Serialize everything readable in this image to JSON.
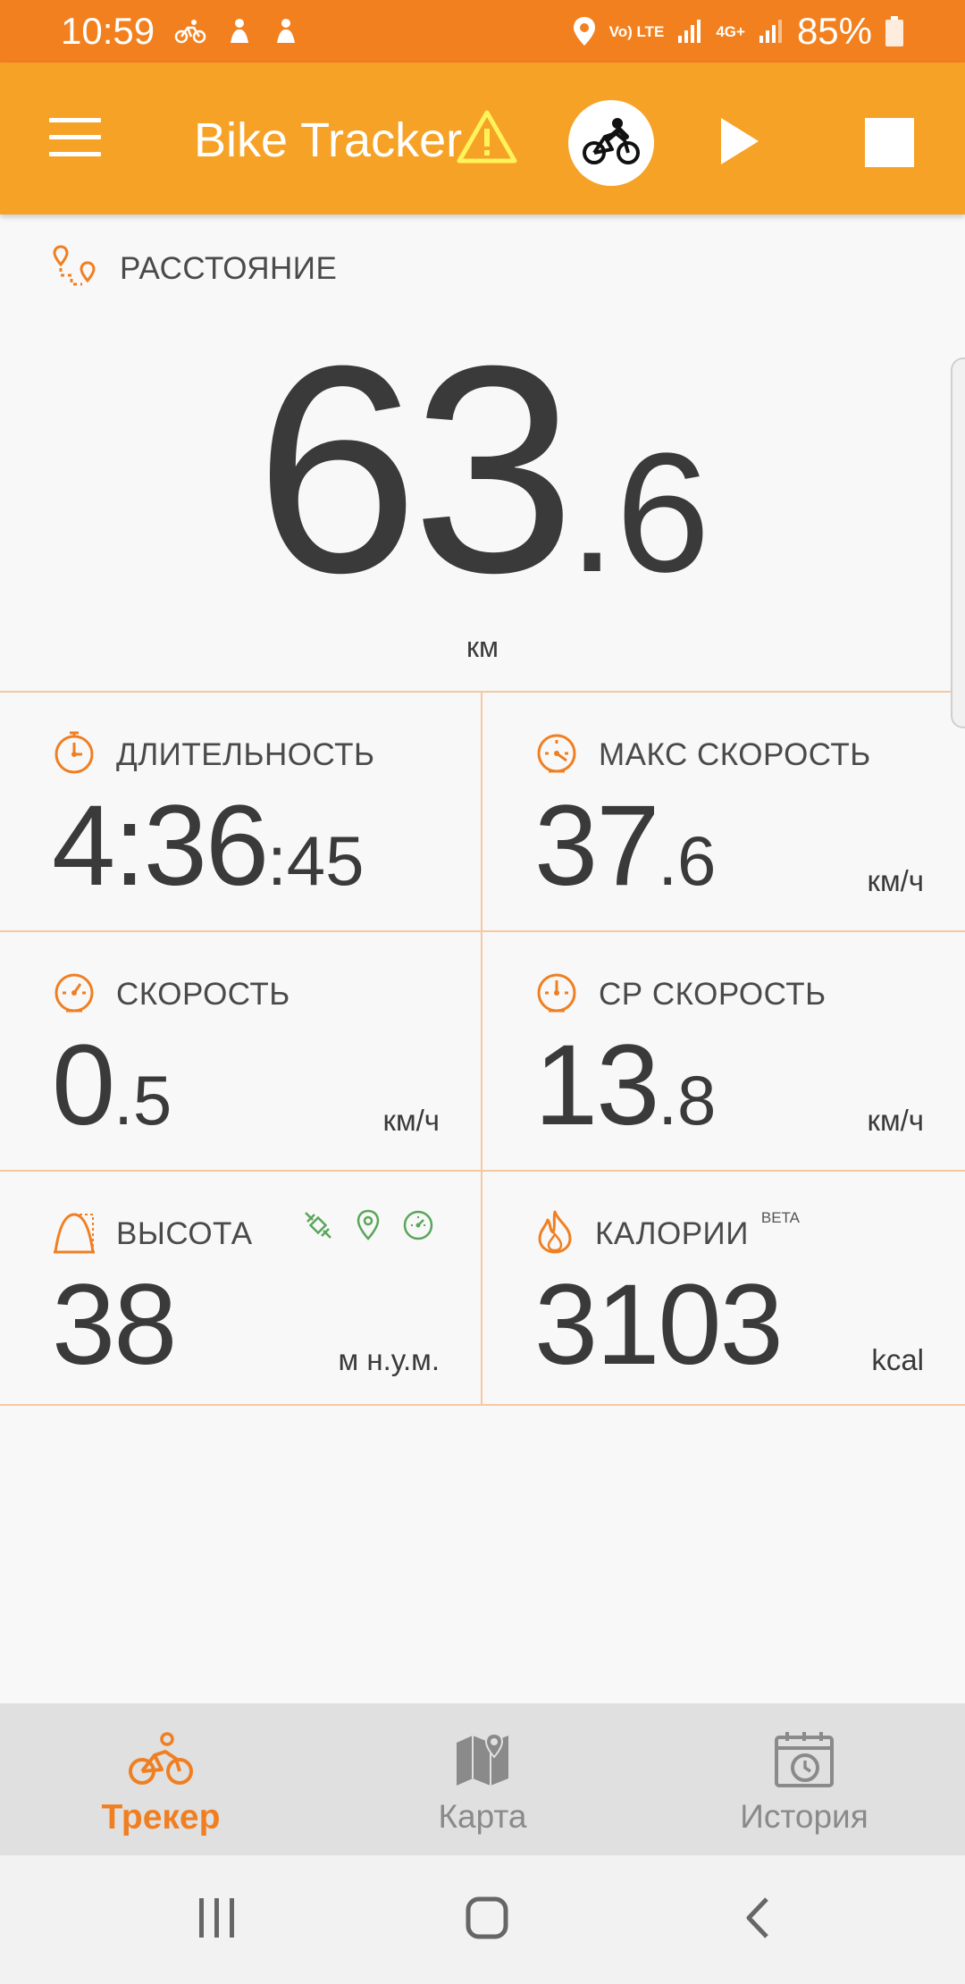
{
  "status_bar": {
    "time": "10:59",
    "battery": "85%",
    "network_lte": "Vo) LTE",
    "network_4g": "4G+"
  },
  "app_bar": {
    "title": "Bike Tracker",
    "menu_icon": "hamburger-menu-icon",
    "warning_icon": "warning-icon",
    "activity_icon": "cyclist-icon",
    "play_icon": "play-icon",
    "stop_icon": "stop-icon"
  },
  "distance": {
    "label": "РАССТОЯНИЕ",
    "value_int": "63",
    "value_dec": ".6",
    "unit": "км"
  },
  "stats": {
    "duration": {
      "label": "ДЛИТЕЛЬНОСТЬ",
      "value_int": "4:36",
      "value_dec": ":45",
      "unit": ""
    },
    "max_speed": {
      "label": "МАКС СКОРОСТЬ",
      "value_int": "37",
      "value_dec": ".6",
      "unit": "км/ч"
    },
    "speed": {
      "label": "СКОРОСТЬ",
      "value_int": "0",
      "value_dec": ".5",
      "unit": "км/ч"
    },
    "avg_speed": {
      "label": "СР СКОРОСТЬ",
      "value_int": "13",
      "value_dec": ".8",
      "unit": "км/ч"
    },
    "altitude": {
      "label": "ВЫСОТА",
      "value_int": "38",
      "value_dec": "",
      "unit": "м н.у.м."
    },
    "calories": {
      "label": "КАЛОРИИ",
      "badge": "BETA",
      "value_int": "3103",
      "value_dec": "",
      "unit": "kcal"
    }
  },
  "bottom_nav": {
    "items": [
      {
        "label": "Трекер",
        "icon": "cyclist-icon",
        "active": true
      },
      {
        "label": "Карта",
        "icon": "map-icon",
        "active": false
      },
      {
        "label": "История",
        "icon": "calendar-history-icon",
        "active": false
      }
    ]
  },
  "colors": {
    "status_bar": "#f3801f",
    "app_bar": "#f6a227",
    "accent": "#f07f22",
    "text": "#3a3a3a",
    "divider": "#f5c8a2",
    "green_icons": "#5aa65a"
  }
}
